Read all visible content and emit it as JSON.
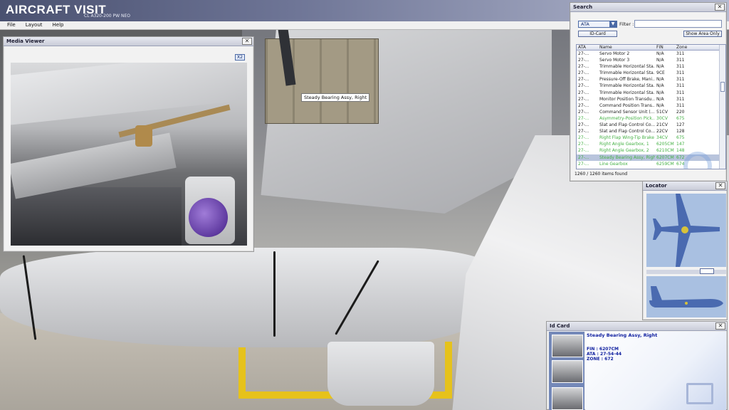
{
  "app": {
    "title": "AIRCRAFT VISIT",
    "subtitle": "CL A320-200 PW NEO"
  },
  "menu": [
    "File",
    "Layout",
    "Help"
  ],
  "media_viewer": {
    "title": "Media Viewer",
    "zoom_label": "X2"
  },
  "tooltip": "Steady Bearing Assy, Right",
  "search": {
    "title": "Search",
    "selected": "ATA",
    "filter_label": "Filter :",
    "filter_value": "",
    "idcard_button": "ID-Card",
    "show_area_button": "Show Area Only",
    "columns": [
      "ATA",
      "Name",
      "FIN",
      "Zone"
    ],
    "rows": [
      {
        "ata": "27-...",
        "name": "Servo Motor 2",
        "fin": "N/A",
        "zone": "311",
        "style": "normal"
      },
      {
        "ata": "27-...",
        "name": "Servo Motor 3",
        "fin": "N/A",
        "zone": "311",
        "style": "normal"
      },
      {
        "ata": "27-...",
        "name": "Trimmable Horizontal Sta...",
        "fin": "N/A",
        "zone": "311",
        "style": "normal"
      },
      {
        "ata": "27-...",
        "name": "Trimmable Horizontal Sta...",
        "fin": "9CE",
        "zone": "311",
        "style": "normal"
      },
      {
        "ata": "27-...",
        "name": "Pressure-Off Brake, Mani...",
        "fin": "N/A",
        "zone": "311",
        "style": "normal"
      },
      {
        "ata": "27-...",
        "name": "Trimmable Horizontal Sta...",
        "fin": "N/A",
        "zone": "311",
        "style": "normal"
      },
      {
        "ata": "27-...",
        "name": "Trimmable Horizontal Sta...",
        "fin": "N/A",
        "zone": "311",
        "style": "normal"
      },
      {
        "ata": "27-...",
        "name": "Monitor Position Transdu...",
        "fin": "N/A",
        "zone": "311",
        "style": "normal"
      },
      {
        "ata": "27-...",
        "name": "Command Position Trans...",
        "fin": "N/A",
        "zone": "311",
        "style": "normal"
      },
      {
        "ata": "27-...",
        "name": "Command Sensor Unit (...",
        "fin": "51CV",
        "zone": "220",
        "style": "normal"
      },
      {
        "ata": "27-...",
        "name": "Asymmetry-Position Pick...",
        "fin": "30CV",
        "zone": "675",
        "style": "green"
      },
      {
        "ata": "27-...",
        "name": "Slat and Flap Control Co...",
        "fin": "21CV",
        "zone": "127",
        "style": "normal"
      },
      {
        "ata": "27-...",
        "name": "Slat and Flap Control Co...",
        "fin": "22CV",
        "zone": "128",
        "style": "normal"
      },
      {
        "ata": "27-...",
        "name": "Right Flap Wing-Tip Brake",
        "fin": "34CV",
        "zone": "675",
        "style": "green"
      },
      {
        "ata": "27-...",
        "name": "Right Angle Gearbox, 1",
        "fin": "6205CM",
        "zone": "147",
        "style": "green"
      },
      {
        "ata": "27-...",
        "name": "Right Angle Gearbox, 2",
        "fin": "6210CM",
        "zone": "148",
        "style": "green"
      },
      {
        "ata": "27-...",
        "name": "Steady Bearing Assy, Right",
        "fin": "6207CM",
        "zone": "672",
        "style": "selected"
      },
      {
        "ata": "27-...",
        "name": "Line Gearbox",
        "fin": "6259CM",
        "zone": "674",
        "style": "green"
      }
    ],
    "status": "1260 / 1260 items found"
  },
  "locator": {
    "title": "Locator"
  },
  "idcard": {
    "title": "Id Card",
    "name": "Steady Bearing Assy, Right",
    "fin": "FIN : 6207CM",
    "ata": "ATA : 27-54-44",
    "zone": "ZONE : 672"
  },
  "colors": {
    "accent": "#4b6aa6",
    "green_row": "#43b043",
    "selected_row": "#b8c4dc",
    "locator_bg": "#a9c0e1",
    "aircraft_silhouette": "#4a6ab0"
  }
}
